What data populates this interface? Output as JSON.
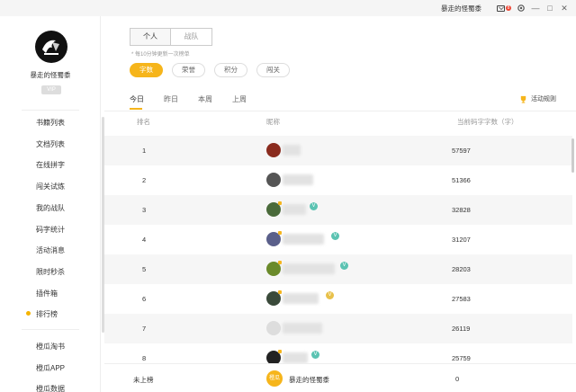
{
  "titlebar": {
    "username": "暴走的怪蜀黍",
    "mail_badge": "8",
    "minimize": "—",
    "maximize": "□",
    "close": "✕"
  },
  "sidebar": {
    "username": "暴走的怪蜀黍",
    "vip_label": "VIP",
    "menu": [
      {
        "label": "书籍列表"
      },
      {
        "label": "文档列表"
      },
      {
        "label": "在线拼字"
      },
      {
        "label": "闯关试炼"
      },
      {
        "label": "我的战队"
      },
      {
        "label": "码字统计"
      },
      {
        "label": "活动消息"
      },
      {
        "label": "限时秒杀"
      },
      {
        "label": "插件箱"
      },
      {
        "label": "排行榜",
        "active": true
      }
    ],
    "bottom": [
      {
        "label": "橙瓜淘书"
      },
      {
        "label": "橙瓜APP"
      },
      {
        "label": "橙瓜数据"
      }
    ]
  },
  "main": {
    "segment": {
      "personal": "个人",
      "team": "战队"
    },
    "hint": "* 每10分钟更新一次榜单",
    "chips": [
      "字数",
      "荣誉",
      "积分",
      "闯关"
    ],
    "tabs": [
      "今日",
      "昨日",
      "本周",
      "上周"
    ],
    "rules_label": "活动规则",
    "table": {
      "headers": {
        "rank": "排名",
        "nick": "昵称",
        "count": "当前码字字数（字）"
      },
      "rows": [
        {
          "rank": "1",
          "count": "57597",
          "avatar_color": "#8a2b1e"
        },
        {
          "rank": "2",
          "count": "51366",
          "avatar_color": "#555555"
        },
        {
          "rank": "3",
          "count": "32828",
          "avatar_color": "#4a6a3a"
        },
        {
          "rank": "4",
          "count": "31207",
          "avatar_color": "#5a5f8a"
        },
        {
          "rank": "5",
          "count": "28203",
          "avatar_color": "#6a8a2a"
        },
        {
          "rank": "6",
          "count": "27583",
          "avatar_color": "#3a4a3a"
        },
        {
          "rank": "7",
          "count": "26119",
          "avatar_color": "#dddddd"
        },
        {
          "rank": "8",
          "count": "25759",
          "avatar_color": "#222222"
        }
      ]
    },
    "footer": {
      "label": "未上榜",
      "avatar_text": "橙瓜",
      "name": "暴走的怪蜀黍",
      "count": "0"
    }
  }
}
